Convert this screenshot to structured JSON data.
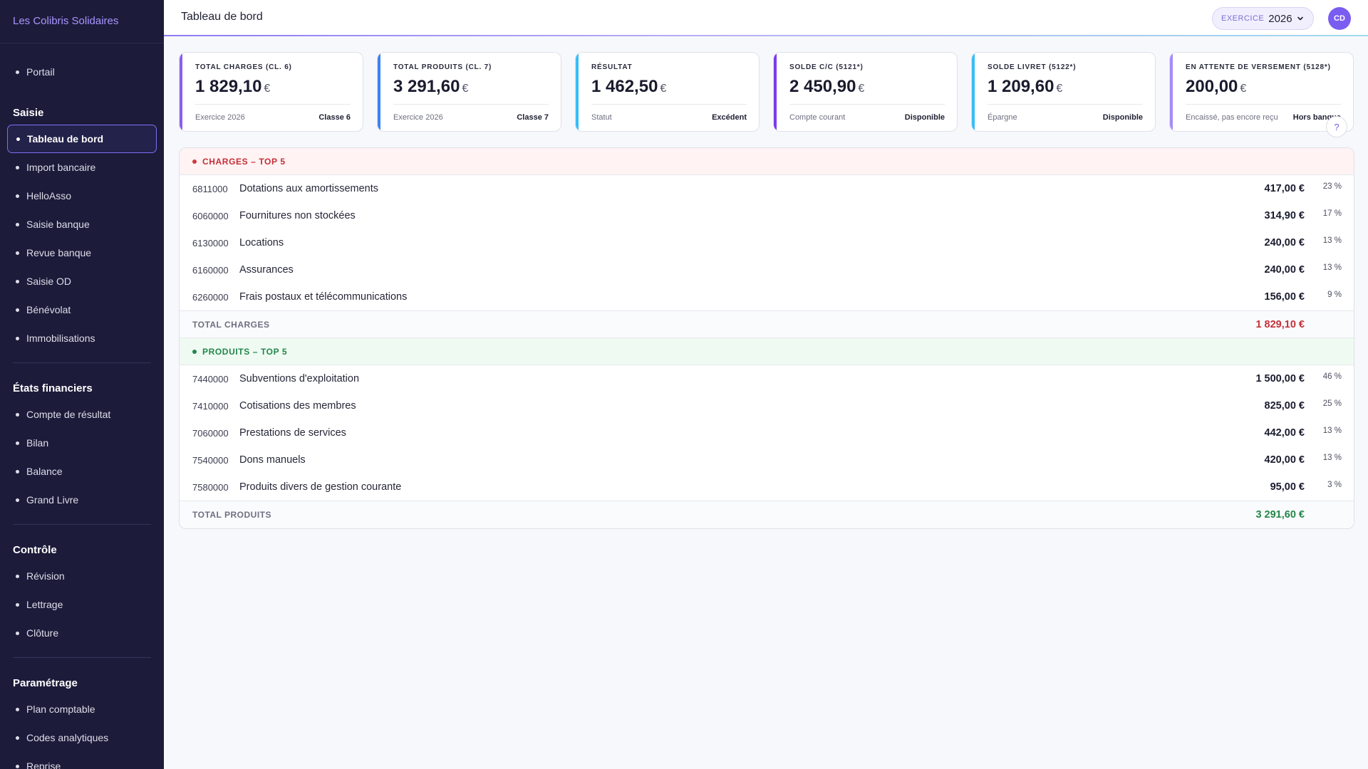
{
  "sidebar": {
    "org_name": "Les Colibris Solidaires",
    "top_items": [
      {
        "label": "Portail"
      }
    ],
    "sections": [
      {
        "title": "Saisie",
        "items": [
          {
            "label": "Tableau de bord"
          },
          {
            "label": "Import bancaire"
          },
          {
            "label": "HelloAsso"
          },
          {
            "label": "Saisie banque"
          },
          {
            "label": "Revue banque"
          },
          {
            "label": "Saisie OD"
          },
          {
            "label": "Bénévolat"
          },
          {
            "label": "Immobilisations"
          }
        ]
      },
      {
        "title": "États financiers",
        "items": [
          {
            "label": "Compte de résultat"
          },
          {
            "label": "Bilan"
          },
          {
            "label": "Balance"
          },
          {
            "label": "Grand Livre"
          }
        ]
      },
      {
        "title": "Contrôle",
        "items": [
          {
            "label": "Révision"
          },
          {
            "label": "Lettrage"
          },
          {
            "label": "Clôture"
          }
        ]
      },
      {
        "title": "Paramétrage",
        "items": [
          {
            "label": "Plan comptable"
          },
          {
            "label": "Codes analytiques"
          },
          {
            "label": "Reprise"
          }
        ]
      }
    ]
  },
  "header": {
    "title": "Tableau de bord",
    "exercice_label": "EXERCICE",
    "exercice_year": "2026",
    "avatar_initials": "CD"
  },
  "kpis": [
    {
      "title": "TOTAL CHARGES (CL. 6)",
      "value": "1 829,10",
      "currency": "€",
      "foot_left": "Exercice 2026",
      "foot_right": "Classe 6",
      "accent": "#8b5cf6"
    },
    {
      "title": "TOTAL PRODUITS (CL. 7)",
      "value": "3 291,60",
      "currency": "€",
      "foot_left": "Exercice 2026",
      "foot_right": "Classe 7",
      "accent": "#3b82f6"
    },
    {
      "title": "RÉSULTAT",
      "value": "1 462,50",
      "currency": "€",
      "foot_left": "Statut",
      "foot_right": "Excédent",
      "accent": "#38bdf8"
    },
    {
      "title": "SOLDE C/C (5121*)",
      "value": "2 450,90",
      "currency": "€",
      "foot_left": "Compte courant",
      "foot_right": "Disponible",
      "accent": "#7c3aed"
    },
    {
      "title": "SOLDE LIVRET (5122*)",
      "value": "1 209,60",
      "currency": "€",
      "foot_left": "Épargne",
      "foot_right": "Disponible",
      "accent": "#38bdf8"
    },
    {
      "title": "EN ATTENTE DE VERSEMENT (5128*)",
      "value": "200,00",
      "currency": "€",
      "foot_left": "Encaissé, pas encore reçu",
      "foot_right": "Hors banque",
      "accent": "#a78bfa"
    }
  ],
  "help_label": "?",
  "charges": {
    "title": "CHARGES – TOP 5",
    "rows": [
      {
        "account": "6811000",
        "label": "Dotations aux amortissements",
        "amount": "417,00 €",
        "pct": "23 %"
      },
      {
        "account": "6060000",
        "label": "Fournitures non stockées",
        "amount": "314,90 €",
        "pct": "17 %"
      },
      {
        "account": "6130000",
        "label": "Locations",
        "amount": "240,00 €",
        "pct": "13 %"
      },
      {
        "account": "6160000",
        "label": "Assurances",
        "amount": "240,00 €",
        "pct": "13 %"
      },
      {
        "account": "6260000",
        "label": "Frais postaux et télécommunications",
        "amount": "156,00 €",
        "pct": "9 %"
      }
    ],
    "total_label": "TOTAL CHARGES",
    "total_value": "1 829,10 €"
  },
  "produits": {
    "title": "PRODUITS – TOP 5",
    "rows": [
      {
        "account": "7440000",
        "label": "Subventions d'exploitation",
        "amount": "1 500,00 €",
        "pct": "46 %"
      },
      {
        "account": "7410000",
        "label": "Cotisations des membres",
        "amount": "825,00 €",
        "pct": "25 %"
      },
      {
        "account": "7060000",
        "label": "Prestations de services",
        "amount": "442,00 €",
        "pct": "13 %"
      },
      {
        "account": "7540000",
        "label": "Dons manuels",
        "amount": "420,00 €",
        "pct": "13 %"
      },
      {
        "account": "7580000",
        "label": "Produits divers de gestion courante",
        "amount": "95,00 €",
        "pct": "3 %"
      }
    ],
    "total_label": "TOTAL PRODUITS",
    "total_value": "3 291,60 €"
  }
}
